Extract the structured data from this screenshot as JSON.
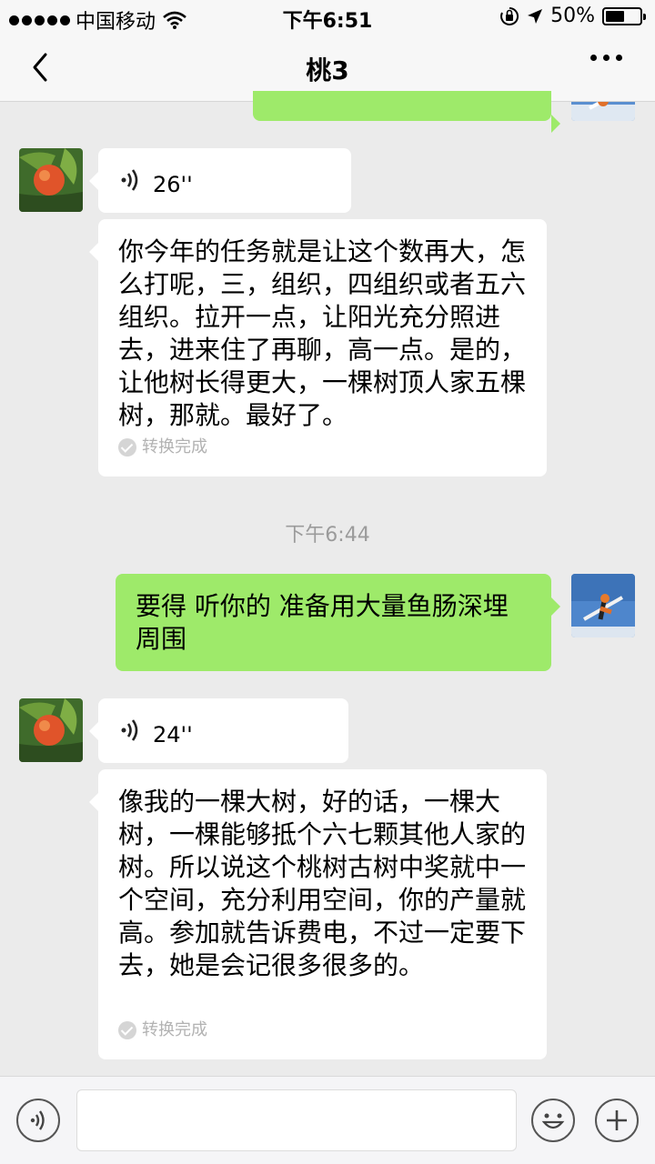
{
  "status_bar": {
    "carrier": "中国移动",
    "time": "下午6:51",
    "battery": "50%",
    "battery_level": 0.5
  },
  "nav": {
    "title": "桃3"
  },
  "messages": {
    "voice_1_duration": "26''",
    "text_1": "你今年的任务就是让这个数再大，怎么打呢，三，组织，四组织或者五六组织。拉开一点，让阳光充分照进去，进来住了再聊，高一点。是的，让他树长得更大，一棵树顶人家五棵树，那就。最好了。",
    "text_1_status": "转换完成",
    "timestamp": "下午6:44",
    "text_2": "要得 听你的 准备用大量鱼肠深埋周围",
    "voice_2_duration": "24''",
    "text_3": "像我的一棵大树，好的话，一棵大树，一棵能够抵个六七颗其他人家的树。所以说这个桃树古树中奖就中一个空间，充分利用空间，你的产量就高。参加就告诉费电，不过一定要下去，她是会记很多很多的。",
    "text_3_status": "转换完成"
  },
  "colors": {
    "sent_bubble": "#9eea6a",
    "received_bubble": "#ffffff",
    "background": "#ebebeb"
  },
  "icons": [
    "signal-dots-icon",
    "wifi-icon",
    "lock-rotation-icon",
    "location-arrow-icon",
    "battery-icon",
    "back-chevron-icon",
    "more-icon",
    "voice-wave-icon",
    "check-icon",
    "voice-input-icon",
    "emoji-icon",
    "plus-icon"
  ]
}
